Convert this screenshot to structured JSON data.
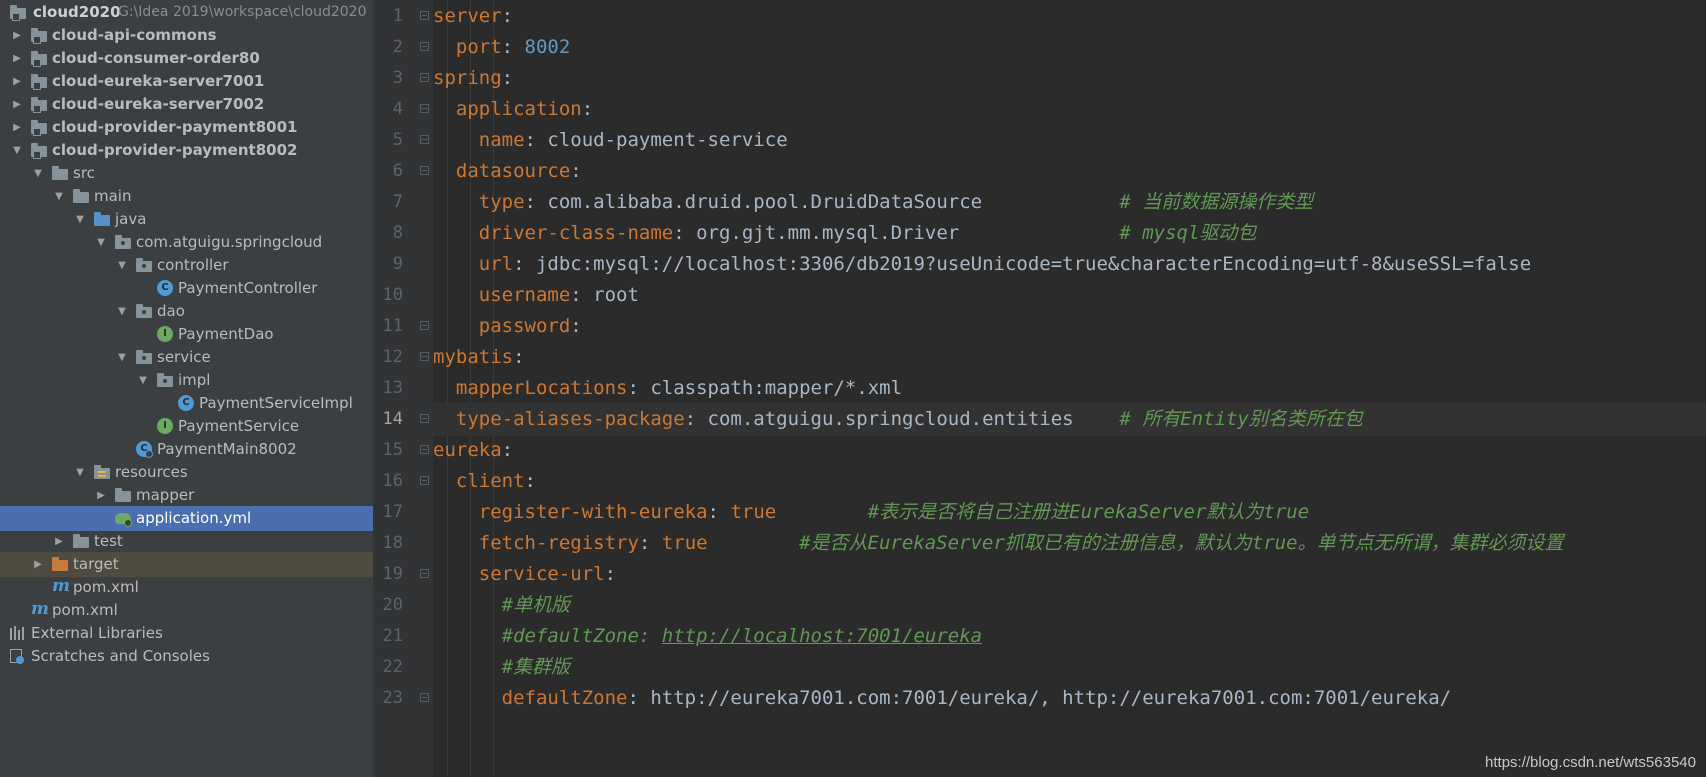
{
  "project_tree": {
    "root": {
      "name": "cloud2020",
      "path": "G:\\Idea 2019\\workspace\\cloud2020"
    },
    "items": [
      {
        "label": "cloud-api-commons",
        "icon": "module-folder-icon",
        "expanded": false
      },
      {
        "label": "cloud-consumer-order80",
        "icon": "module-folder-icon",
        "expanded": false
      },
      {
        "label": "cloud-eureka-server7001",
        "icon": "module-folder-icon",
        "expanded": false
      },
      {
        "label": "cloud-eureka-server7002",
        "icon": "module-folder-icon",
        "expanded": false
      },
      {
        "label": "cloud-provider-payment8001",
        "icon": "module-folder-icon",
        "expanded": false
      },
      {
        "label": "cloud-provider-payment8002",
        "icon": "module-folder-icon",
        "expanded": true
      },
      {
        "label": "src",
        "icon": "folder-icon",
        "expanded": true
      },
      {
        "label": "main",
        "icon": "folder-icon",
        "expanded": true
      },
      {
        "label": "java",
        "icon": "source-folder-icon",
        "expanded": true
      },
      {
        "label": "com.atguigu.springcloud",
        "icon": "package-icon",
        "expanded": true
      },
      {
        "label": "controller",
        "icon": "package-icon",
        "expanded": true
      },
      {
        "label": "PaymentController",
        "icon": "class-icon"
      },
      {
        "label": "dao",
        "icon": "package-icon",
        "expanded": true
      },
      {
        "label": "PaymentDao",
        "icon": "interface-icon"
      },
      {
        "label": "service",
        "icon": "package-icon",
        "expanded": true
      },
      {
        "label": "impl",
        "icon": "package-icon",
        "expanded": true
      },
      {
        "label": "PaymentServiceImpl",
        "icon": "class-icon"
      },
      {
        "label": "PaymentService",
        "icon": "interface-icon"
      },
      {
        "label": "PaymentMain8002",
        "icon": "spring-boot-class-icon"
      },
      {
        "label": "resources",
        "icon": "resources-folder-icon",
        "expanded": true
      },
      {
        "label": "mapper",
        "icon": "folder-icon",
        "expanded": false
      },
      {
        "label": "application.yml",
        "icon": "yaml-file-icon",
        "selected": true
      },
      {
        "label": "test",
        "icon": "folder-icon",
        "expanded": false
      },
      {
        "label": "target",
        "icon": "excluded-folder-icon",
        "expanded": false
      },
      {
        "label": "pom.xml",
        "icon": "maven-icon"
      },
      {
        "label": "pom.xml",
        "icon": "maven-icon"
      },
      {
        "label": "External Libraries",
        "icon": "libraries-icon"
      },
      {
        "label": "Scratches and Consoles",
        "icon": "scratches-icon"
      }
    ]
  },
  "editor": {
    "active_line": 14,
    "lines": [
      {
        "num": "1",
        "tokens": [
          [
            "k",
            "server"
          ],
          [
            "p",
            ":"
          ]
        ]
      },
      {
        "num": "2",
        "tokens": [
          [
            "s",
            "  "
          ],
          [
            "k",
            "port"
          ],
          [
            "p",
            ": "
          ],
          [
            "n",
            "8002"
          ]
        ]
      },
      {
        "num": "3",
        "tokens": [
          [
            "k",
            "spring"
          ],
          [
            "p",
            ":"
          ]
        ]
      },
      {
        "num": "4",
        "tokens": [
          [
            "s",
            "  "
          ],
          [
            "k",
            "application"
          ],
          [
            "p",
            ":"
          ]
        ]
      },
      {
        "num": "5",
        "tokens": [
          [
            "s",
            "    "
          ],
          [
            "k",
            "name"
          ],
          [
            "p",
            ": cloud-payment-service"
          ]
        ]
      },
      {
        "num": "6",
        "tokens": [
          [
            "s",
            "  "
          ],
          [
            "k",
            "datasource"
          ],
          [
            "p",
            ":"
          ]
        ]
      },
      {
        "num": "7",
        "tokens": [
          [
            "s",
            "    "
          ],
          [
            "k",
            "type"
          ],
          [
            "p",
            ": com.alibaba.druid.pool.DruidDataSource            "
          ],
          [
            "c",
            "# 当前数据源操作类型"
          ]
        ]
      },
      {
        "num": "8",
        "tokens": [
          [
            "s",
            "    "
          ],
          [
            "k",
            "driver-class-name"
          ],
          [
            "p",
            ": org.gjt.mm.mysql.Driver              "
          ],
          [
            "c",
            "# mysql驱动包"
          ]
        ]
      },
      {
        "num": "9",
        "tokens": [
          [
            "s",
            "    "
          ],
          [
            "k",
            "url"
          ],
          [
            "p",
            ": jdbc:mysql://localhost:3306/db2019?useUnicode=true&characterEncoding=utf-8&useSSL=false"
          ]
        ]
      },
      {
        "num": "10",
        "tokens": [
          [
            "s",
            "    "
          ],
          [
            "k",
            "username"
          ],
          [
            "p",
            ": root"
          ]
        ]
      },
      {
        "num": "11",
        "tokens": [
          [
            "s",
            "    "
          ],
          [
            "k",
            "password"
          ],
          [
            "p",
            ":"
          ]
        ]
      },
      {
        "num": "12",
        "tokens": [
          [
            "k",
            "mybatis"
          ],
          [
            "p",
            ":"
          ]
        ]
      },
      {
        "num": "13",
        "tokens": [
          [
            "s",
            "  "
          ],
          [
            "k",
            "mapperLocations"
          ],
          [
            "p",
            ": classpath:mapper/*.xml"
          ]
        ]
      },
      {
        "num": "14",
        "tokens": [
          [
            "s",
            "  "
          ],
          [
            "k",
            "type-aliases-package"
          ],
          [
            "p",
            ": com.atguigu.springcloud.entities    "
          ],
          [
            "c",
            "# 所有Entity别名类所在包"
          ]
        ]
      },
      {
        "num": "15",
        "tokens": [
          [
            "k",
            "eureka"
          ],
          [
            "p",
            ":"
          ]
        ]
      },
      {
        "num": "16",
        "tokens": [
          [
            "s",
            "  "
          ],
          [
            "k",
            "client"
          ],
          [
            "p",
            ":"
          ]
        ]
      },
      {
        "num": "17",
        "tokens": [
          [
            "s",
            "    "
          ],
          [
            "k",
            "register-with-eureka"
          ],
          [
            "p",
            ": "
          ],
          [
            "k",
            "true"
          ],
          [
            "p",
            "        "
          ],
          [
            "c",
            "#表示是否将自己注册进EurekaServer默认为true"
          ]
        ]
      },
      {
        "num": "18",
        "tokens": [
          [
            "s",
            "    "
          ],
          [
            "k",
            "fetch-registry"
          ],
          [
            "p",
            ": "
          ],
          [
            "k",
            "true"
          ],
          [
            "p",
            "        "
          ],
          [
            "c",
            "#是否从EurekaServer抓取已有的注册信息，默认为true。单节点无所谓，集群必须设置"
          ]
        ]
      },
      {
        "num": "19",
        "tokens": [
          [
            "s",
            "    "
          ],
          [
            "k",
            "service-url"
          ],
          [
            "p",
            ":"
          ]
        ]
      },
      {
        "num": "20",
        "tokens": [
          [
            "s",
            "      "
          ],
          [
            "c",
            "#单机版"
          ]
        ]
      },
      {
        "num": "21",
        "tokens": [
          [
            "s",
            "      "
          ],
          [
            "c",
            "#defaultZone: "
          ],
          [
            "u",
            "http://localhost:7001/eureka"
          ]
        ]
      },
      {
        "num": "22",
        "tokens": [
          [
            "s",
            "      "
          ],
          [
            "c",
            "#集群版"
          ]
        ]
      },
      {
        "num": "23",
        "tokens": [
          [
            "s",
            "      "
          ],
          [
            "k",
            "defaultZone"
          ],
          [
            "p",
            ": http://eureka7001.com:7001/eureka/, http://eureka7001.com:7001/eureka/"
          ]
        ]
      }
    ]
  },
  "watermark": "https://blog.csdn.net/wts563540",
  "colors": {
    "tree_bg": "#3c3f41",
    "selection": "#4b6eaf",
    "editor_bg": "#2b2b2b",
    "gutter_bg": "#313335",
    "keyword": "#cc7832",
    "number": "#6897bb",
    "comment": "#629755",
    "text": "#a9b7c6"
  }
}
